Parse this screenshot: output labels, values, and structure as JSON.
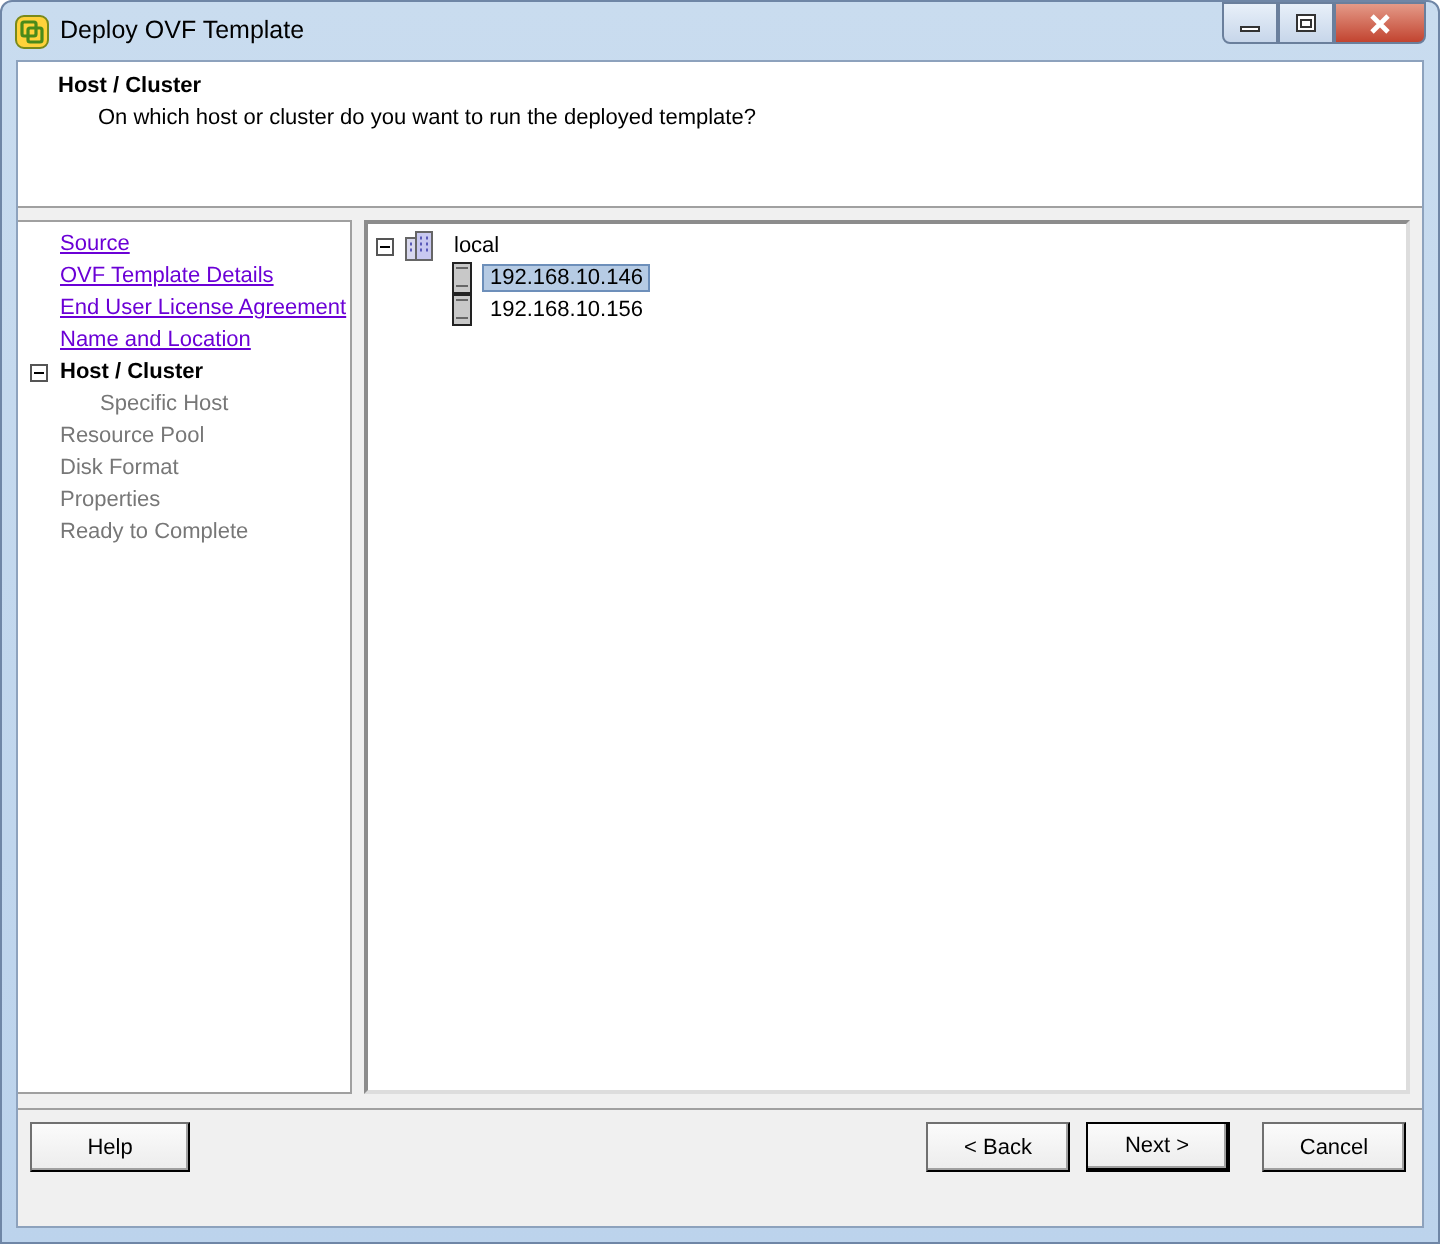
{
  "window": {
    "title": "Deploy OVF Template"
  },
  "header": {
    "title": "Host / Cluster",
    "description": "On which host or cluster do you want to run the deployed template?"
  },
  "steps": [
    {
      "label": "Source",
      "kind": "link"
    },
    {
      "label": "OVF Template Details",
      "kind": "link"
    },
    {
      "label": "End User License Agreement",
      "kind": "link"
    },
    {
      "label": "Name and Location",
      "kind": "link"
    },
    {
      "label": "Host / Cluster",
      "kind": "current",
      "expanded": true,
      "children": [
        {
          "label": "Specific Host",
          "kind": "pending"
        }
      ]
    },
    {
      "label": "Resource Pool",
      "kind": "pending"
    },
    {
      "label": "Disk Format",
      "kind": "pending"
    },
    {
      "label": "Properties",
      "kind": "pending"
    },
    {
      "label": "Ready to Complete",
      "kind": "pending"
    }
  ],
  "tree": [
    {
      "label": "local",
      "kind": "cluster",
      "expanded": true,
      "selected": false,
      "children": [
        {
          "label": "192.168.10.146",
          "kind": "host",
          "selected": true
        },
        {
          "label": "192.168.10.156",
          "kind": "host",
          "selected": false
        }
      ]
    }
  ],
  "buttons": {
    "left": [
      {
        "label": "Help",
        "default": false
      }
    ],
    "right": [
      {
        "label": "< Back",
        "default": false
      },
      {
        "label": "Next >",
        "default": true
      },
      {
        "label": "Cancel",
        "default": false
      }
    ]
  }
}
